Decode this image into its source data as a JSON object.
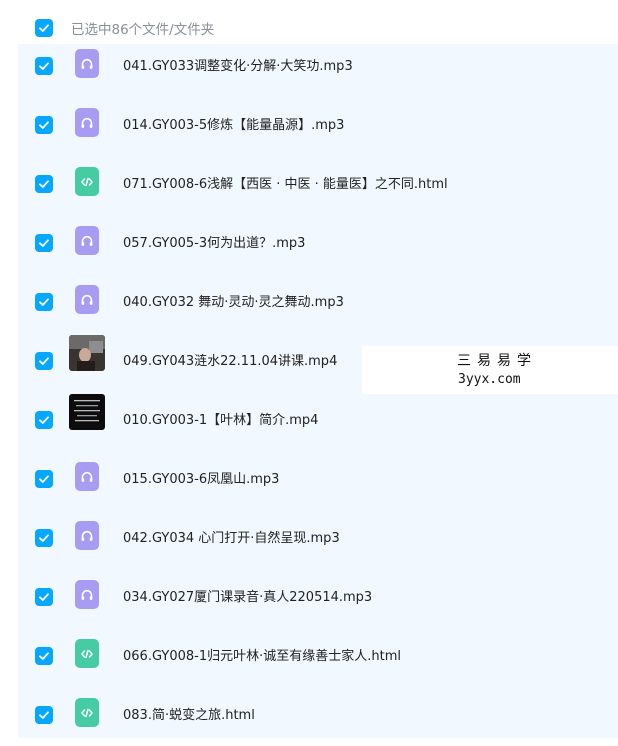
{
  "header": {
    "selection_text": "已选中86个文件/文件夹"
  },
  "files": [
    {
      "name": "041.GY033调整变化·分解·大笑功.mp3",
      "type": "audio"
    },
    {
      "name": "014.GY003-5修炼【能量晶源】.mp3",
      "type": "audio"
    },
    {
      "name": "071.GY008-6浅解【西医 · 中医 · 能量医】之不同.html",
      "type": "html"
    },
    {
      "name": "057.GY005-3何为出道？.mp3",
      "type": "audio"
    },
    {
      "name": "040.GY032 舞动·灵动·灵之舞动.mp3",
      "type": "audio"
    },
    {
      "name": "049.GY043涟水22.11.04讲课.mp4",
      "type": "video"
    },
    {
      "name": "010.GY003-1【叶林】简介.mp4",
      "type": "video"
    },
    {
      "name": "015.GY003-6凤凰山.mp3",
      "type": "audio"
    },
    {
      "name": "042.GY034 心门打开·自然呈现.mp3",
      "type": "audio"
    },
    {
      "name": "034.GY027厦门课录音·真人220514.mp3",
      "type": "audio"
    },
    {
      "name": "066.GY008-1归元叶林·诚至有缘善士家人.html",
      "type": "html"
    },
    {
      "name": "083.简·蜕变之旅.html",
      "type": "html"
    }
  ],
  "watermark": {
    "line1": "三易易学",
    "line2": "3yyx.com"
  },
  "colors": {
    "checkbox": "#06a7ff",
    "audio_icon": "#a89cf2",
    "html_icon": "#45cca3",
    "list_bg": "#f1f8ff"
  },
  "icons": {
    "audio": "headphones-icon",
    "html": "code-icon",
    "check": "check-icon"
  }
}
